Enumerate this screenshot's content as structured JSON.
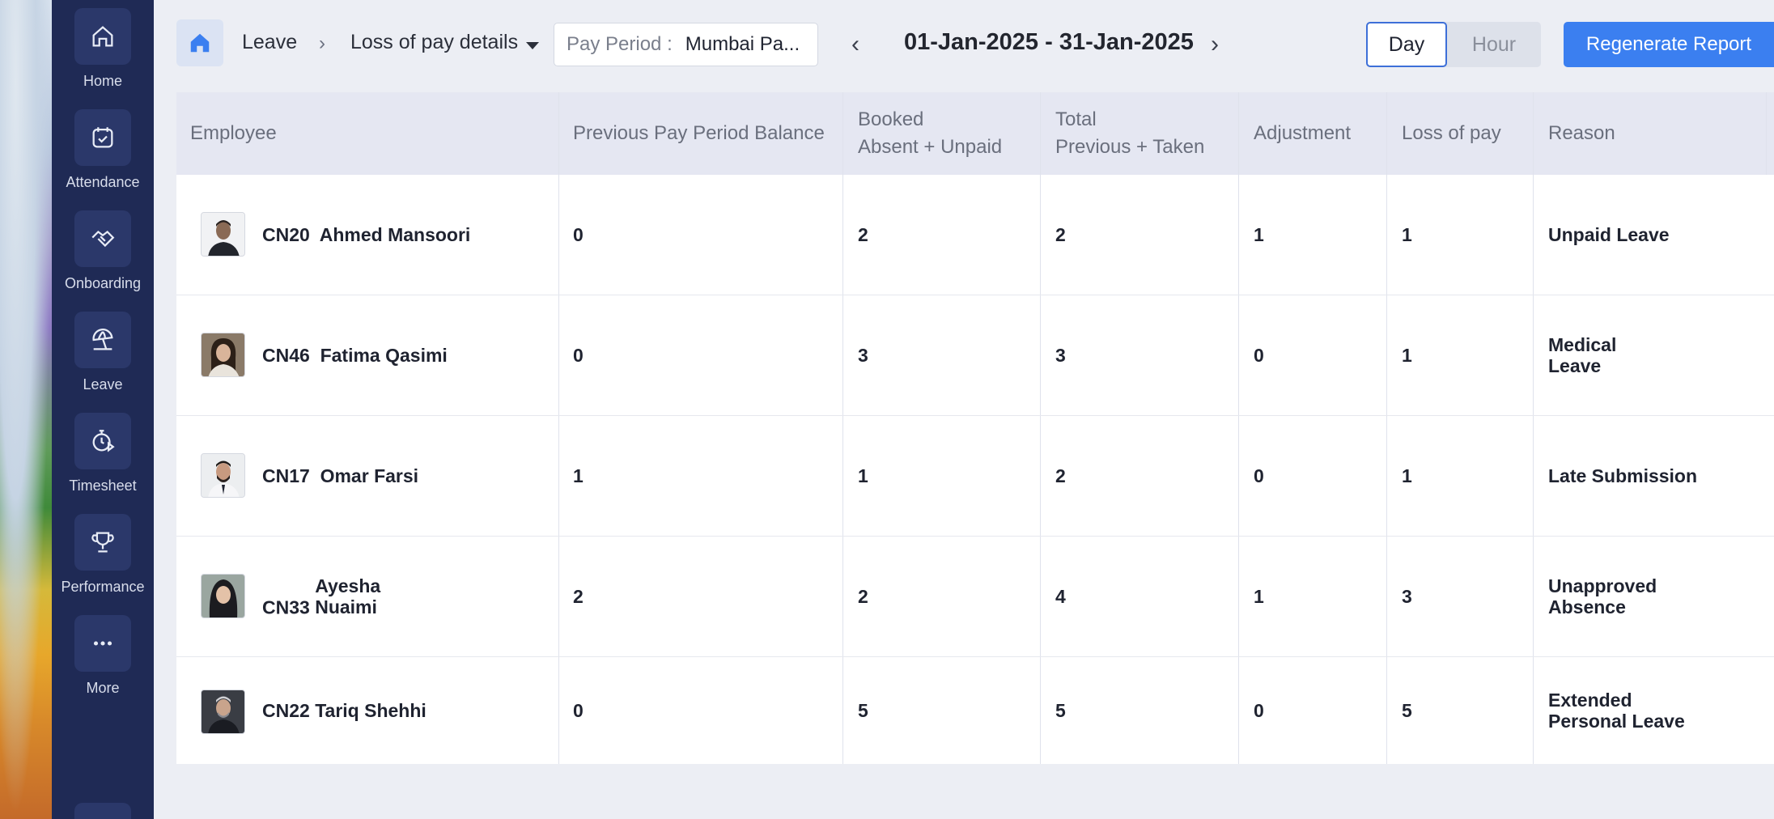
{
  "sidebar": {
    "items": [
      {
        "label": "Home",
        "icon": "home-icon"
      },
      {
        "label": "Attendance",
        "icon": "calendar-check-icon"
      },
      {
        "label": "Onboarding",
        "icon": "handshake-icon"
      },
      {
        "label": "Leave",
        "icon": "beach-umbrella-icon"
      },
      {
        "label": "Timesheet",
        "icon": "stopwatch-icon"
      },
      {
        "label": "Performance",
        "icon": "trophy-icon"
      },
      {
        "label": "More",
        "icon": "more-dots-icon"
      }
    ]
  },
  "header": {
    "breadcrumb_leave": "Leave",
    "breadcrumb_page": "Loss of pay details",
    "pay_period_label": "Pay Period :",
    "pay_period_value": "Mumbai Pa...",
    "date_range": "01-Jan-2025 - 31-Jan-2025",
    "toggle_day": "Day",
    "toggle_hour": "Hour",
    "regenerate_label": "Regenerate Report"
  },
  "table": {
    "headers": {
      "employee": "Employee",
      "prev_balance": "Previous Pay Period Balance",
      "booked_line1": "Booked",
      "booked_line2": "Absent + Unpaid",
      "total_line1": "Total",
      "total_line2": "Previous + Taken",
      "adjustment": "Adjustment",
      "loss_of_pay": "Loss of pay",
      "reason": "Reason"
    },
    "rows": [
      {
        "id": "CN20",
        "name": "Ahmed Mansoori",
        "prev": "0",
        "booked": "2",
        "total": "2",
        "adjustment": "1",
        "lop": "1",
        "reason": "Unpaid Leave"
      },
      {
        "id": "CN46",
        "name": "Fatima Qasimi",
        "prev": "0",
        "booked": "3",
        "total": "3",
        "adjustment": "0",
        "lop": "1",
        "reason": "Medical Leave"
      },
      {
        "id": "CN17",
        "name": "Omar Farsi",
        "prev": "1",
        "booked": "1",
        "total": "2",
        "adjustment": "0",
        "lop": "1",
        "reason": "Late Submission"
      },
      {
        "id": "CN33",
        "name": "Ayesha Nuaimi",
        "prev": "2",
        "booked": "2",
        "total": "4",
        "adjustment": "1",
        "lop": "3",
        "reason": "Unapproved Absence"
      },
      {
        "id": "CN22",
        "name": "Tariq Shehhi",
        "prev": "0",
        "booked": "5",
        "total": "5",
        "adjustment": "0",
        "lop": "5",
        "reason": "Extended Personal Leave"
      }
    ]
  },
  "colors": {
    "sidebar": "#1f2a55",
    "accent": "#3b7ff0",
    "header_row": "#e5e7f2"
  }
}
